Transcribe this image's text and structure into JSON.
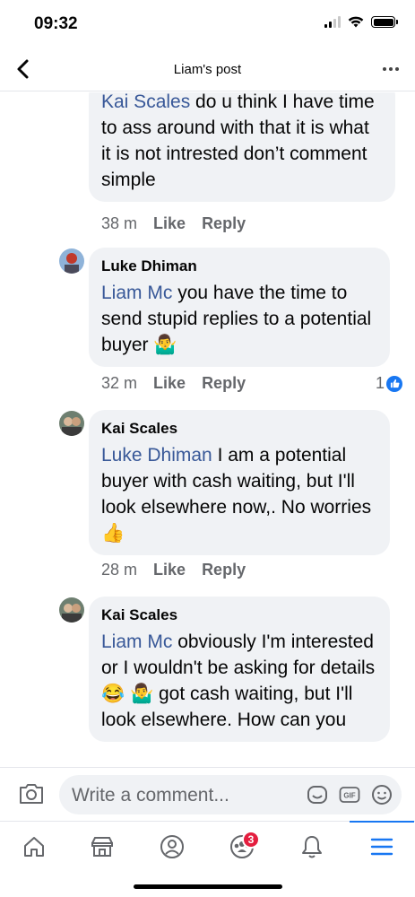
{
  "status_bar": {
    "time": "09:32"
  },
  "header": {
    "title": "Liam's post"
  },
  "comments": [
    {
      "author": "",
      "mention": "Kai Scales",
      "text": " do u think I have time to ass around with that it is what it is not intrested don’t comment simple",
      "time": "38 m",
      "like_label": "Like",
      "reply_label": "Reply"
    },
    {
      "author": "Luke Dhiman",
      "mention": "Liam Mc",
      "text": " you have the time to send stupid replies to a potential buyer 🤷‍♂️",
      "time": "32 m",
      "like_label": "Like",
      "reply_label": "Reply",
      "reaction_count": "1"
    },
    {
      "author": "Kai Scales",
      "mention": "Luke Dhiman",
      "text": " I am a potential buyer with cash waiting, but I'll look elsewhere now,. No worries 👍",
      "time": "28 m",
      "like_label": "Like",
      "reply_label": "Reply"
    },
    {
      "author": "Kai Scales",
      "mention": "Liam Mc",
      "text": " obviously I'm interested or I wouldn't be asking for details 😂 🤷‍♂️ got cash waiting, but I'll look elsewhere. How can you"
    }
  ],
  "composer": {
    "placeholder": "Write a comment..."
  },
  "tabbar": {
    "notification_count": "3"
  },
  "colors": {
    "accent": "#1877f2",
    "mention": "#385898",
    "bubble": "#f0f2f5",
    "badge": "#e41e3f"
  }
}
